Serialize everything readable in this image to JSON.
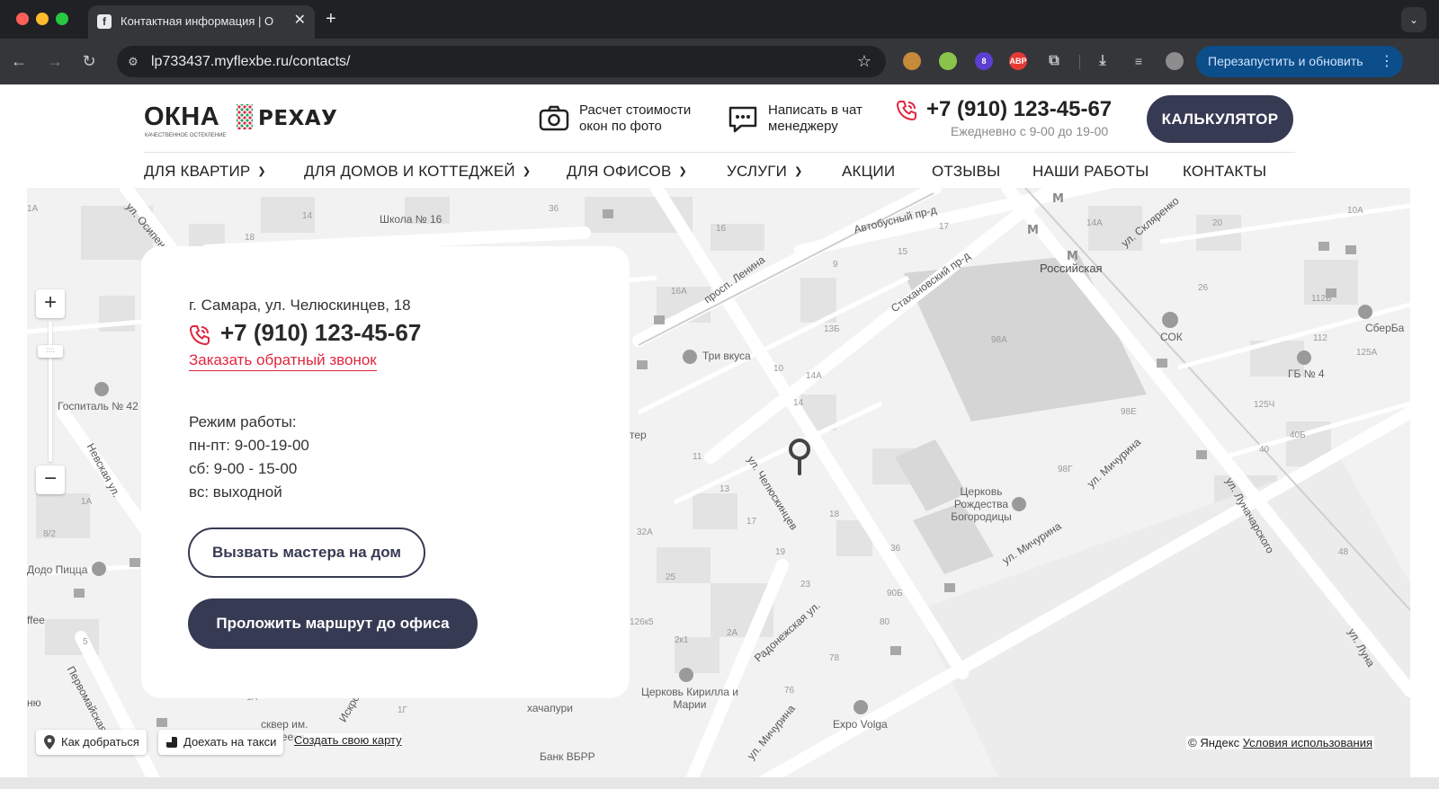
{
  "browser": {
    "tab_title": "Контактная информация | О",
    "tab_favicon": "f",
    "url": "lp733437.myflexbe.ru/contacts/",
    "relaunch_label": "Перезапустить и обновить",
    "ext_badge": "8",
    "ext_abp": "ABP"
  },
  "header": {
    "logo_okna": "ОКНА",
    "logo_sub": "КАЧЕСТВЕННОЕ ОСТЕКЛЕНИЕ",
    "logo_rehau": "РЕХАУ",
    "photo_calc": "Расчет стоимости окон по фото",
    "chat": "Написать в чат менеджеру",
    "phone": "+7 (910) 123-45-67",
    "hours": "Ежедневно с 9-00 до 19-00",
    "calc_button": "КАЛЬКУЛЯТОР"
  },
  "menu": {
    "apartments": "ДЛЯ КВАРТИР",
    "houses": "ДЛЯ ДОМОВ И КОТТЕДЖЕЙ",
    "offices": "ДЛЯ ОФИСОВ",
    "services": "УСЛУГИ",
    "promo": "АКЦИИ",
    "reviews": "ОТЗЫВЫ",
    "works": "НАШИ РАБОТЫ",
    "contacts": "КОНТАКТЫ"
  },
  "card": {
    "address": "г. Самара, ул. Челюскинцев, 18",
    "phone": "+7 (910) 123-45-67",
    "callback_link": "Заказать обратный звонок",
    "hours_title": "Режим работы:",
    "hours_weekdays": "пн-пт: 9-00-19-00",
    "hours_saturday": "сб: 9-00 - 15-00",
    "hours_sunday": "вс: выходной",
    "btn_master": "Вызвать мастера на дом",
    "btn_route": "Проложить маршрут до офиса"
  },
  "map": {
    "route_btn": "Как добраться",
    "taxi_btn": "Доехать на такси",
    "create_map": "Создать свою карту",
    "copyright": "© Яндекс",
    "terms": "Условия использования",
    "labels": {
      "school16": "Школа № 16",
      "hospital42": "Госпиталь № 42",
      "nevskaya": "Невская ул.",
      "osipenko": "ул. Осипенко",
      "avtobus": "Автобусный пр-д",
      "lenina": "просп. Ленина",
      "stakhanov": "Стахановский пр-д",
      "rossiyskaya": "Российская",
      "sklyarenko": "ул. Скляренко",
      "tri_vkusa": "Три вкуса",
      "sok": "СОК",
      "sberbank": "СберБа",
      "gb4": "ГБ № 4",
      "chelyuskintsev": "ул. Челюскинцев",
      "church_rozhd": "Церковь Рождества Богородицы",
      "michurina1": "ул. Мичурина",
      "michurina2": "ул. Мичурина",
      "michurina3": "ул. Мичурина",
      "lunacharskogo": "ул. Луначарского",
      "lunach2": "ул. Луна",
      "radonezh": "Радонежская ул.",
      "church_kirill": "Церковь Кирилла и Марии",
      "expo": "Expo Volga",
      "dodo": "Додо Пицца",
      "skver": "сквер им. Фадеева",
      "khachapuri": "хачапури",
      "bank": "Банк ВБРР",
      "pervomay": "Первомайская",
      "iskra": "Искро",
      "office": "ffee",
      "ter": "тер",
      "un": "ню",
      "n98a": "98А",
      "n98e": "98Е",
      "n98g": "98Г",
      "n14a": "14А",
      "n14a2": "14А",
      "n16a": "16А",
      "n13b": "13Б",
      "n15": "15",
      "n17": "17",
      "n16": "16",
      "n18": "18",
      "n14": "14",
      "n9": "9",
      "n10": "10",
      "n11": "11",
      "n13": "13",
      "n17b": "17",
      "n19": "19",
      "n23": "23",
      "n25": "25",
      "n32a": "32А",
      "n36": "36",
      "n90b": "90Б",
      "n80": "80",
      "n78": "78",
      "n76": "76",
      "n2a": "2А",
      "n2k1": "2к1",
      "n126k5": "126к5",
      "n112b": "112Б",
      "n112": "112",
      "n125a": "125А",
      "n125ch": "125Ч",
      "n40b": "40Б",
      "n40": "40",
      "n48": "48",
      "n26": "26",
      "n20": "20",
      "n10a": "10А",
      "n1a": "1А",
      "n1a2": "1А",
      "n8_2": "8/2",
      "n5": "5",
      "n14s": "14",
      "n18s": "18",
      "n36s": "36",
      "n1g": "1Г",
      "n1a3": "1А"
    }
  }
}
